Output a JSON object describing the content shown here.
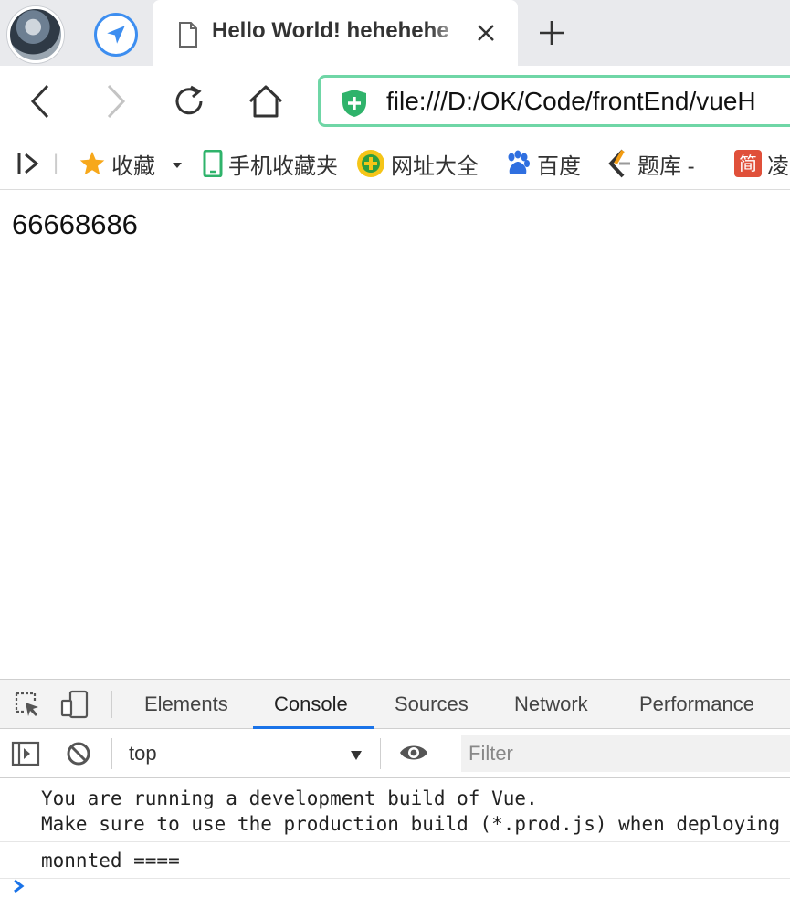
{
  "browser": {
    "tab": {
      "title": "Hello World! hehehehe"
    },
    "address_bar": {
      "url": "file:///D:/OK/Code/frontEnd/vueH"
    },
    "bookmarks": [
      {
        "label": "收藏",
        "icon": "star-icon"
      },
      {
        "label": "手机收藏夹",
        "icon": "phone-icon"
      },
      {
        "label": "网址大全",
        "icon": "site-nav-icon"
      },
      {
        "label": "百度",
        "icon": "baidu-paw-icon"
      },
      {
        "label": "题库 -",
        "icon": "tiku-icon"
      },
      {
        "label": "凌",
        "icon": "jian-icon"
      }
    ]
  },
  "page": {
    "text": "66668686"
  },
  "devtools": {
    "tabs": [
      "Elements",
      "Console",
      "Sources",
      "Network",
      "Performance"
    ],
    "active_tab": "Console",
    "context": "top",
    "filter_placeholder": "Filter",
    "messages": [
      "You are running a development build of Vue.\nMake sure to use the production build (*.prod.js) when deploying",
      "monnted ===="
    ]
  },
  "colors": {
    "accent_blue": "#1a73e8",
    "address_border": "#6fd6a6",
    "shield_green": "#2fb36b"
  }
}
